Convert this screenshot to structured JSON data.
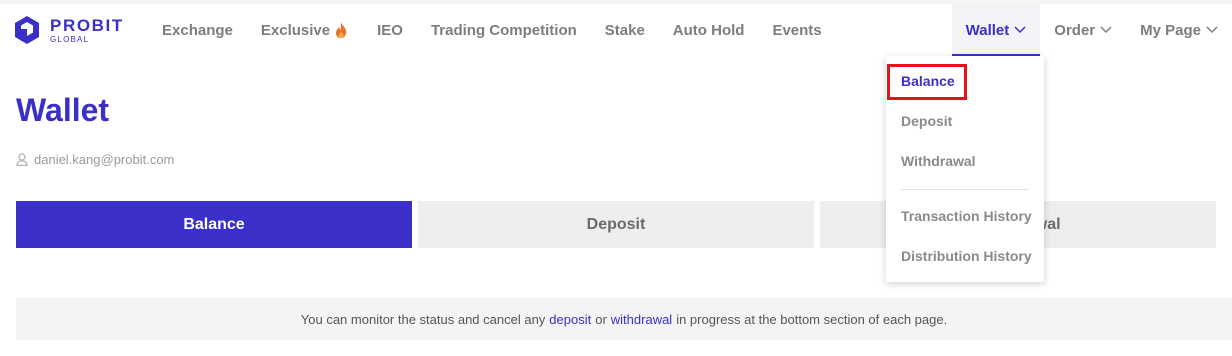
{
  "brand": {
    "name": "PROBIT",
    "sub": "GLOBAL",
    "color": "#3b2fc9"
  },
  "nav": {
    "items": [
      {
        "label": "Exchange"
      },
      {
        "label": "Exclusive",
        "icon": "flame-icon"
      },
      {
        "label": "IEO"
      },
      {
        "label": "Trading Competition"
      },
      {
        "label": "Stake"
      },
      {
        "label": "Auto Hold"
      },
      {
        "label": "Events"
      }
    ],
    "right": [
      {
        "label": "Wallet",
        "active": true
      },
      {
        "label": "Order"
      },
      {
        "label": "My Page"
      }
    ]
  },
  "wallet_menu": {
    "items": [
      {
        "label": "Balance",
        "active": true
      },
      {
        "label": "Deposit"
      },
      {
        "label": "Withdrawal"
      },
      {
        "label": "Transaction History"
      },
      {
        "label": "Distribution History"
      }
    ]
  },
  "page": {
    "title": "Wallet",
    "user_email": "daniel.kang@probit.com"
  },
  "tabs": [
    {
      "label": "Balance",
      "active": true
    },
    {
      "label": "Deposit"
    },
    {
      "label": "Withdrawal"
    }
  ],
  "notice": {
    "prefix": "You can monitor the status and cancel any",
    "link1": "deposit",
    "middle": "or",
    "link2": "withdrawal",
    "suffix": "in progress at the bottom section of each page."
  },
  "colors": {
    "accent": "#3b2fc9",
    "highlight": "#e2131b",
    "muted": "#7d7d7d"
  }
}
